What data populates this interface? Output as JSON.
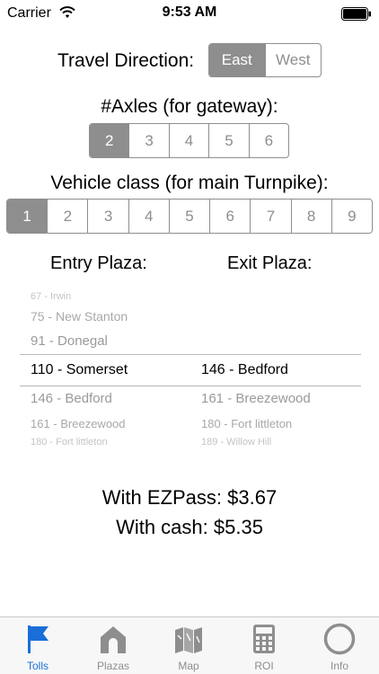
{
  "status_bar": {
    "carrier": "Carrier",
    "time": "9:53 AM"
  },
  "direction": {
    "label": "Travel Direction:",
    "options": [
      "East",
      "West"
    ],
    "selected": "East"
  },
  "axles": {
    "label": "#Axles (for gateway):",
    "options": [
      "2",
      "3",
      "4",
      "5",
      "6"
    ],
    "selected": "2"
  },
  "vehicle_class": {
    "label": "Vehicle class (for main Turnpike):",
    "options": [
      "1",
      "2",
      "3",
      "4",
      "5",
      "6",
      "7",
      "8",
      "9"
    ],
    "selected": "1"
  },
  "entry": {
    "header": "Entry Plaza:",
    "above": [
      "67 - Irwin",
      "75 - New Stanton",
      "91 - Donegal"
    ],
    "selected": "110 - Somerset",
    "below": [
      "146 - Bedford",
      "161 - Breezewood",
      "180 - Fort littleton"
    ]
  },
  "exit": {
    "header": "Exit Plaza:",
    "selected": "146 - Bedford",
    "below": [
      "161 - Breezewood",
      "180 - Fort littleton",
      "189 - Willow Hill"
    ]
  },
  "totals": {
    "ezpass": "With EZPass: $3.67",
    "cash": "With cash: $5.35"
  },
  "tabs": [
    {
      "label": "Tolls",
      "icon": "flag-icon",
      "active": true
    },
    {
      "label": "Plazas",
      "icon": "house-icon",
      "active": false
    },
    {
      "label": "Map",
      "icon": "map-icon",
      "active": false
    },
    {
      "label": "ROI",
      "icon": "calculator-icon",
      "active": false
    },
    {
      "label": "Info",
      "icon": "info-circle-icon",
      "active": false
    }
  ],
  "colors": {
    "accent": "#1a6ed8",
    "segment": "#8e8e8e",
    "tab_inactive": "#8e8e8e"
  }
}
